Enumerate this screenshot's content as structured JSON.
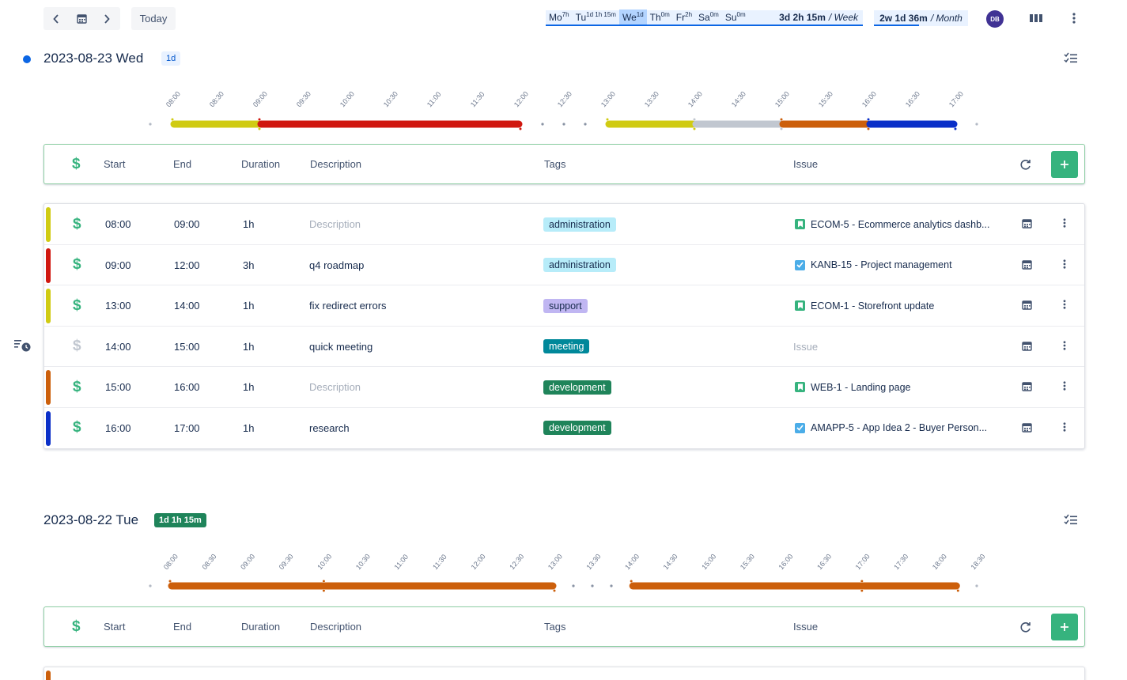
{
  "nav": {
    "today_label": "Today"
  },
  "week": {
    "days": [
      {
        "label": "Mo",
        "value": "7h",
        "active": false
      },
      {
        "label": "Tu",
        "value": "1d 1h 15m",
        "active": false
      },
      {
        "label": "We",
        "value": "1d",
        "active": true
      },
      {
        "label": "Th",
        "value": "0m",
        "active": false
      },
      {
        "label": "Fr",
        "value": "2h",
        "active": false
      },
      {
        "label": "Sa",
        "value": "0m",
        "active": false
      },
      {
        "label": "Su",
        "value": "0m",
        "active": false
      }
    ],
    "total": "3d 2h 15m",
    "per": "/ Week"
  },
  "month": {
    "total": "2w 1d 36m",
    "per": "/ Month"
  },
  "user": {
    "initials": "DB"
  },
  "colors": {
    "yellow": "#d0cb12",
    "red": "#d0170f",
    "gray": "#c1c7d0",
    "orange": "#cc5f0b",
    "blue": "#0a2fc8",
    "green": "#36b37e",
    "accent": "#0c66e4"
  },
  "columns": {
    "start": "Start",
    "end": "End",
    "duration": "Duration",
    "description": "Description",
    "tags": "Tags",
    "issue": "Issue"
  },
  "day1": {
    "title": "2023-08-23 Wed",
    "badge": "1d",
    "timeline": {
      "ticks": [
        "08:00",
        "08:30",
        "09:00",
        "09:30",
        "10:00",
        "10:30",
        "11:00",
        "11:30",
        "12:00",
        "12:30",
        "13:00",
        "13:30",
        "14:00",
        "14:30",
        "15:00",
        "15:30",
        "16:00",
        "16:30",
        "17:00"
      ],
      "segments": [
        {
          "start": "08:00",
          "end": "09:00",
          "color": "yellow"
        },
        {
          "start": "09:00",
          "end": "12:00",
          "color": "red"
        },
        {
          "start": "13:00",
          "end": "14:00",
          "color": "yellow"
        },
        {
          "start": "14:00",
          "end": "15:00",
          "color": "gray"
        },
        {
          "start": "15:00",
          "end": "16:00",
          "color": "orange"
        },
        {
          "start": "16:00",
          "end": "17:00",
          "color": "blue"
        }
      ]
    },
    "entries": [
      {
        "color": "yellow",
        "billable": true,
        "start": "08:00",
        "end": "09:00",
        "duration": "1h",
        "description": "",
        "description_placeholder": "Description",
        "tag": "administration",
        "tag_bg": "#b7ecf9",
        "tag_fg": "#172b4d",
        "issue_type": "story",
        "issue_key": "ECOM-5",
        "issue_title": "Ecommerce analytics dashb..."
      },
      {
        "color": "red",
        "billable": true,
        "start": "09:00",
        "end": "12:00",
        "duration": "3h",
        "description": "q4 roadmap",
        "description_placeholder": "",
        "tag": "administration",
        "tag_bg": "#b7ecf9",
        "tag_fg": "#172b4d",
        "issue_type": "task",
        "issue_key": "KANB-15",
        "issue_title": "Project management"
      },
      {
        "color": "yellow",
        "billable": true,
        "start": "13:00",
        "end": "14:00",
        "duration": "1h",
        "description": "fix redirect errors",
        "description_placeholder": "",
        "tag": "support",
        "tag_bg": "#c0b6f2",
        "tag_fg": "#172b4d",
        "issue_type": "story",
        "issue_key": "ECOM-1",
        "issue_title": "Storefront update"
      },
      {
        "color": "",
        "billable": false,
        "start": "14:00",
        "end": "15:00",
        "duration": "1h",
        "description": "quick meeting",
        "description_placeholder": "",
        "tag": "meeting",
        "tag_bg": "#00889a",
        "tag_fg": "#ffffff",
        "issue_type": "",
        "issue_key": "",
        "issue_title": "",
        "issue_placeholder": "Issue"
      },
      {
        "color": "orange",
        "billable": true,
        "start": "15:00",
        "end": "16:00",
        "duration": "1h",
        "description": "",
        "description_placeholder": "Description",
        "tag": "development",
        "tag_bg": "#1f845a",
        "tag_fg": "#ffffff",
        "issue_type": "story",
        "issue_key": "WEB-1",
        "issue_title": "Landing page"
      },
      {
        "color": "blue",
        "billable": true,
        "start": "16:00",
        "end": "17:00",
        "duration": "1h",
        "description": "research",
        "description_placeholder": "",
        "tag": "development",
        "tag_bg": "#1f845a",
        "tag_fg": "#ffffff",
        "issue_type": "task",
        "issue_key": "AMAPP-5",
        "issue_title": "App Idea 2 - Buyer Person..."
      }
    ]
  },
  "day2": {
    "title": "2023-08-22 Tue",
    "badge": "1d 1h 15m",
    "timeline": {
      "ticks": [
        "08:00",
        "08:30",
        "09:00",
        "09:30",
        "10:00",
        "10:30",
        "11:00",
        "11:30",
        "12:00",
        "12:30",
        "13:00",
        "13:30",
        "14:00",
        "14:30",
        "15:00",
        "15:30",
        "16:00",
        "16:30",
        "17:00",
        "17:30",
        "18:00",
        "18:30"
      ],
      "segments": [
        {
          "start": "08:00",
          "end": "10:00",
          "color": "orange"
        },
        {
          "start": "10:00",
          "end": "13:00",
          "color": "orange"
        },
        {
          "start": "14:00",
          "end": "17:00",
          "color": "orange"
        },
        {
          "start": "17:00",
          "end": "18:15",
          "color": "orange"
        }
      ]
    },
    "entries": [
      {
        "color": "orange",
        "tag_bg": "#00889a"
      }
    ]
  }
}
